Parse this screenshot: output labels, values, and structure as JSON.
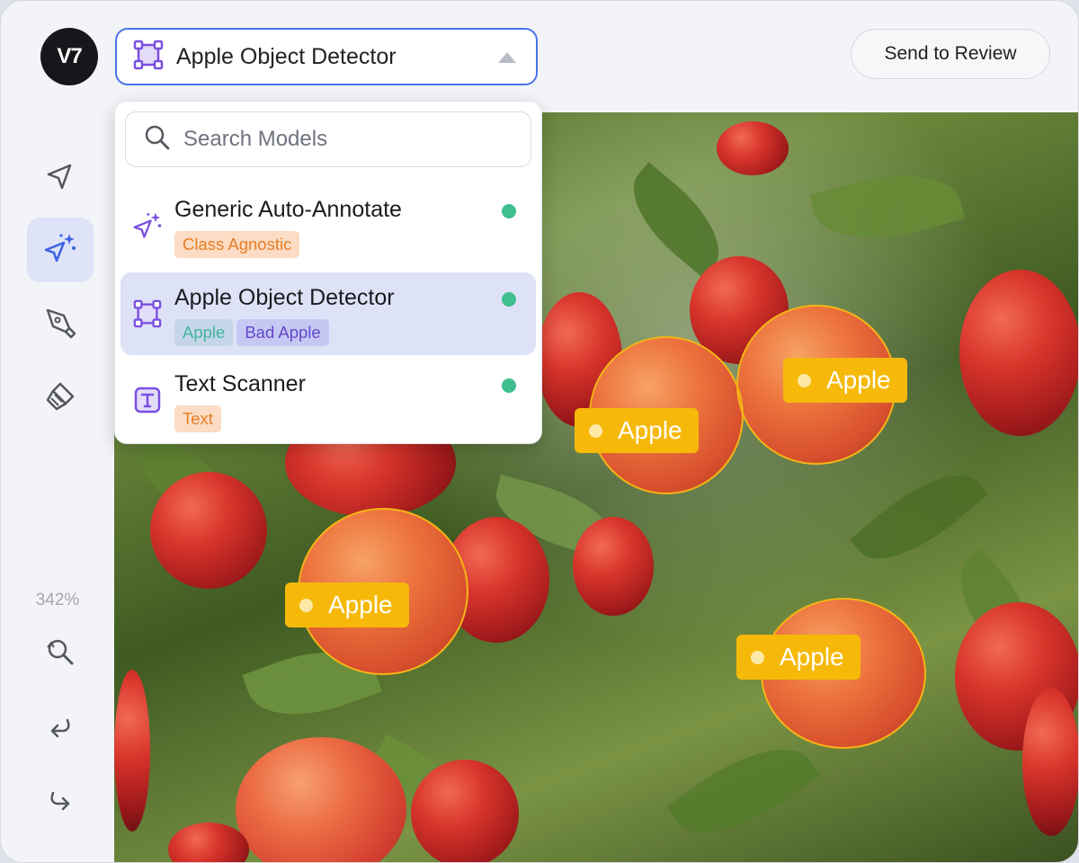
{
  "app": {
    "logo_text": "V7"
  },
  "model_selector": {
    "selected_label": "Apple Object Detector",
    "icon": "bounding-box-icon"
  },
  "header": {
    "review_button": "Send to Review"
  },
  "sidebar": {
    "tools": [
      {
        "name": "select-tool",
        "icon": "cursor-arrow-icon",
        "active": false
      },
      {
        "name": "auto-annotate-tool",
        "icon": "sparkle-cursor-icon",
        "active": true
      },
      {
        "name": "pen-tool",
        "icon": "pen-icon",
        "active": false
      },
      {
        "name": "brush-tool",
        "icon": "brush-icon",
        "active": false
      }
    ],
    "zoom": "342%",
    "actions": [
      "zoom-reset-icon",
      "undo-icon",
      "redo-icon"
    ]
  },
  "dropdown": {
    "search_placeholder": "Search Models",
    "options": [
      {
        "name": "Generic Auto-Annotate",
        "icon": "sparkle-cursor-icon",
        "tags": [
          "Class Agnostic"
        ],
        "status": "online"
      },
      {
        "name": "Apple Object Detector",
        "icon": "bounding-box-icon",
        "tags": [
          "Apple",
          "Bad Apple"
        ],
        "status": "online",
        "selected": true
      },
      {
        "name": "Text Scanner",
        "icon": "text-box-icon",
        "tags": [
          "Text"
        ],
        "status": "online"
      }
    ]
  },
  "annotations": [
    {
      "label": "Apple"
    },
    {
      "label": "Apple"
    },
    {
      "label": "Apple"
    },
    {
      "label": "Apple"
    },
    {
      "label": "Apple"
    }
  ],
  "colors": {
    "accent": "#4a73e8",
    "annotation": "#f6b90a",
    "status_online": "#3fbf8e",
    "tool_active_bg": "#dfe3f8"
  }
}
